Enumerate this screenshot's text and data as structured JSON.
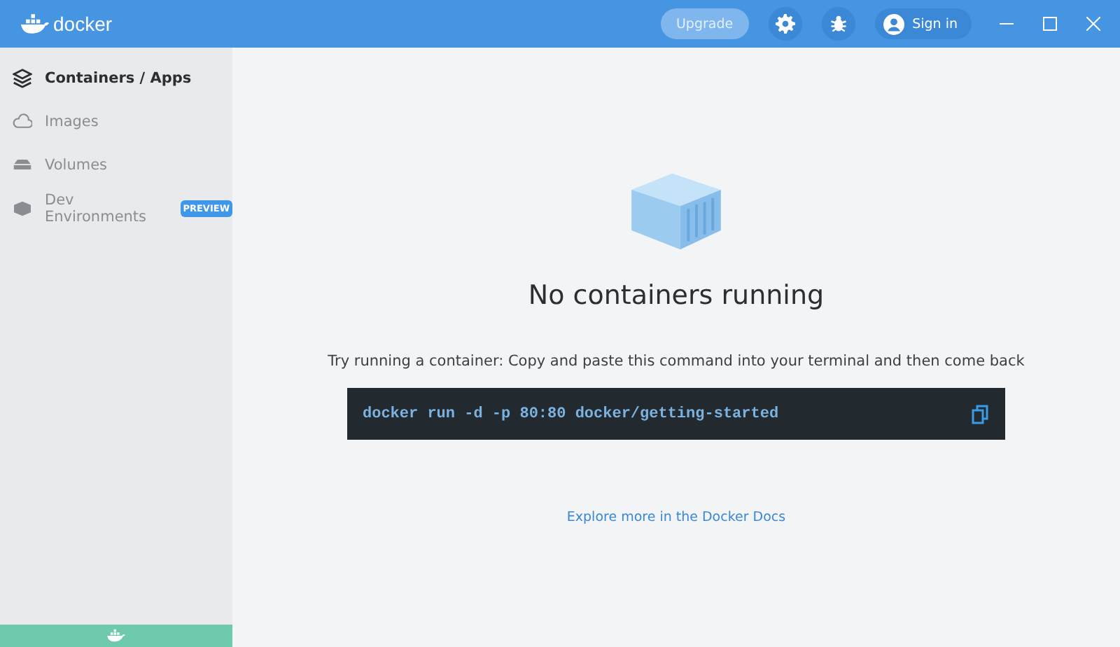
{
  "app": {
    "logo_text": "docker"
  },
  "toolbar": {
    "upgrade": "Upgrade",
    "sign_in": "Sign in"
  },
  "sidebar": {
    "items": [
      {
        "label": "Containers / Apps",
        "selected": true
      },
      {
        "label": "Images",
        "selected": false
      },
      {
        "label": "Volumes",
        "selected": false
      },
      {
        "label": "Dev Environments",
        "selected": false,
        "badge": "PREVIEW"
      }
    ]
  },
  "empty_state": {
    "title": "No containers running",
    "instruction": "Try running a container: Copy and paste this command into your terminal and then come back",
    "command": "docker run -d -p 80:80 docker/getting-started",
    "link": "Explore more in the Docker Docs"
  }
}
